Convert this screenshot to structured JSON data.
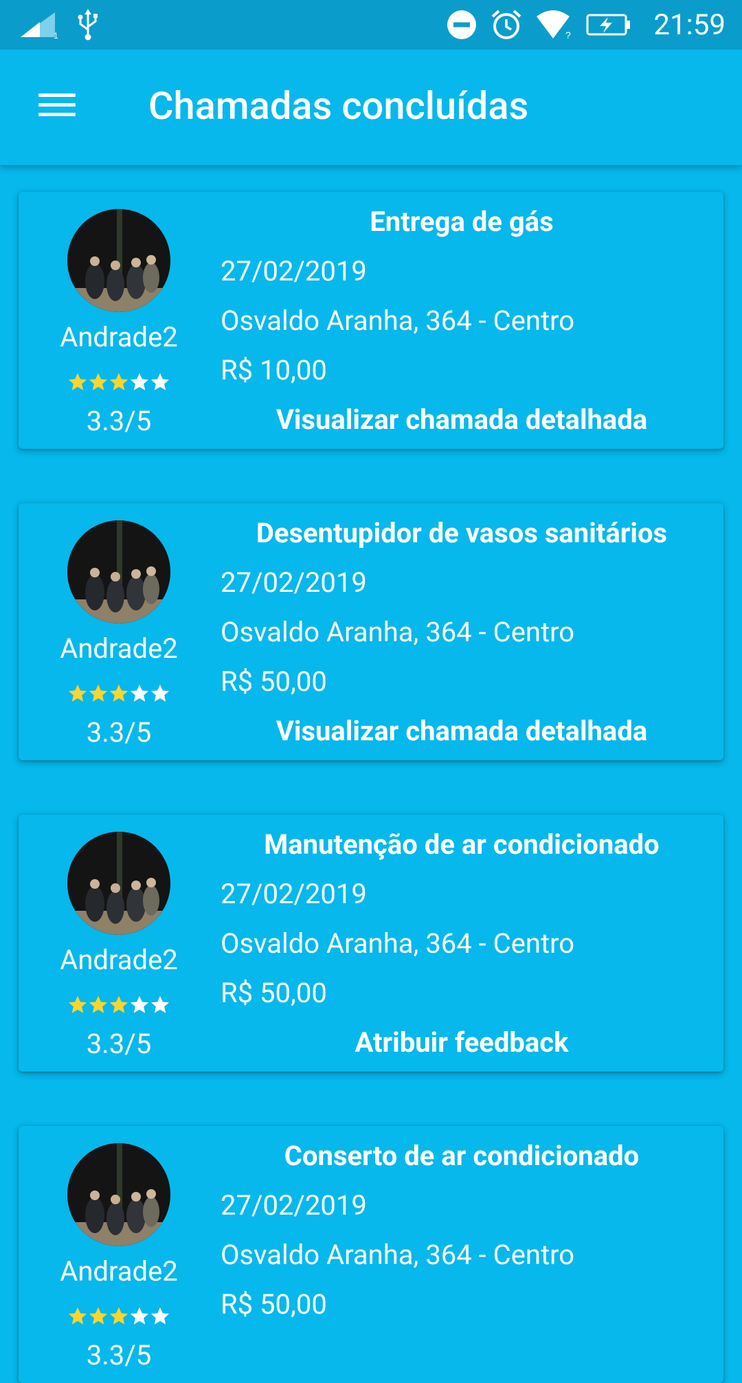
{
  "status_bar": {
    "time": "21:59",
    "icons": [
      "signal-icon",
      "usb-icon",
      "do-not-disturb-icon",
      "alarm-icon",
      "wifi-icon",
      "battery-charging-icon"
    ]
  },
  "app_bar": {
    "title": "Chamadas concluídas",
    "menu_icon": "hamburger-menu-icon"
  },
  "colors": {
    "primary": "#06b8ec",
    "status_bar": "#0a9dcb",
    "star_filled": "#fbd52e",
    "star_empty": "#ffffff"
  },
  "cards": [
    {
      "service": "Entrega de gás",
      "date": "27/02/2019",
      "address": "Osvaldo Aranha, 364 - Centro",
      "price": "R$ 10,00",
      "user": "Andrade2",
      "stars_filled": 3,
      "stars_total": 5,
      "score": "3.3/5",
      "action": "Visualizar chamada detalhada"
    },
    {
      "service": "Desentupidor de vasos sanitários",
      "date": "27/02/2019",
      "address": "Osvaldo Aranha, 364 - Centro",
      "price": "R$ 50,00",
      "user": "Andrade2",
      "stars_filled": 3,
      "stars_total": 5,
      "score": "3.3/5",
      "action": "Visualizar chamada detalhada"
    },
    {
      "service": "Manutenção de ar condicionado",
      "date": "27/02/2019",
      "address": "Osvaldo Aranha, 364 - Centro",
      "price": "R$ 50,00",
      "user": "Andrade2",
      "stars_filled": 3,
      "stars_total": 5,
      "score": "3.3/5",
      "action": "Atribuir feedback"
    },
    {
      "service": "Conserto de ar condicionado",
      "date": "27/02/2019",
      "address": "Osvaldo Aranha, 364 - Centro",
      "price": "R$ 50,00",
      "user": "Andrade2",
      "stars_filled": 3,
      "stars_total": 5,
      "score": "3.3/5",
      "action": ""
    }
  ]
}
